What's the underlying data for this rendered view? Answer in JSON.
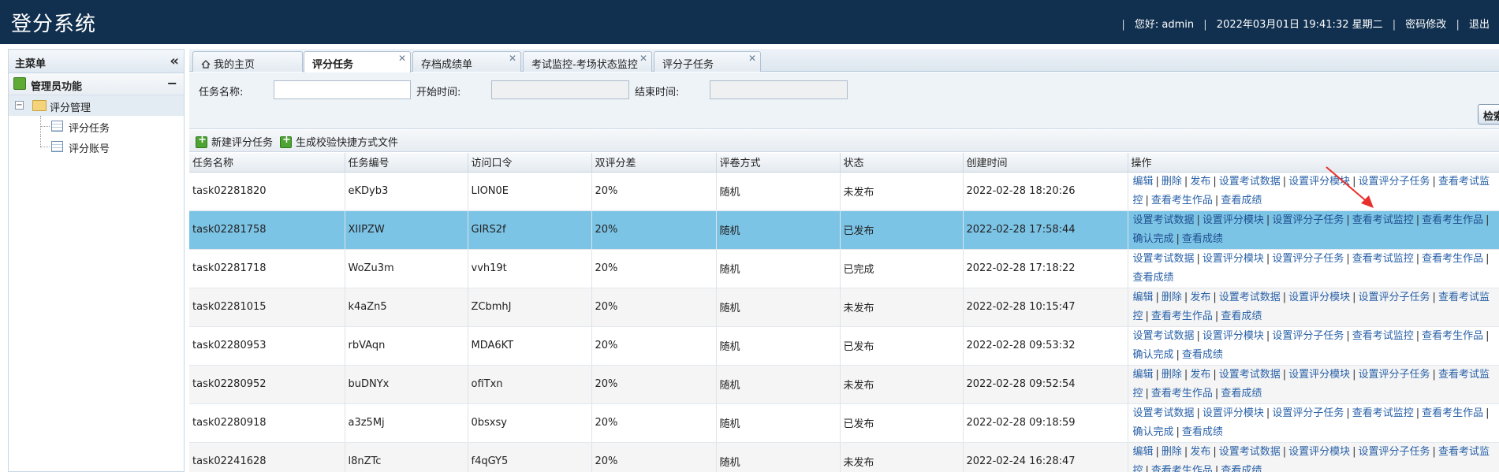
{
  "header": {
    "app_title": "登分系统",
    "greeting": "您好: admin",
    "datetime": "2022年03月01日 19:41:32 星期二",
    "change_password": "密码修改",
    "logout": "退出"
  },
  "sidebar": {
    "title": "主菜单",
    "collapse_icon": "«",
    "section_title": "管理员功能",
    "section_toggle": "−",
    "tree": {
      "root_label": "评分管理",
      "root_toggle": "−",
      "items": [
        {
          "label": "评分任务"
        },
        {
          "label": "评分账号"
        }
      ]
    }
  },
  "tabs": [
    {
      "label": "我的主页"
    },
    {
      "label": "评分任务",
      "active": true
    },
    {
      "label": "存档成绩单"
    },
    {
      "label": "考试监控-考场状态监控"
    },
    {
      "label": "评分子任务"
    }
  ],
  "search": {
    "task_name_label": "任务名称:",
    "task_name_value": "",
    "start_time_label": "开始时间:",
    "start_time_value": "",
    "end_time_label": "结束时间:",
    "end_time_value": "",
    "search_button": "检索"
  },
  "toolbar": {
    "new_task": "新建评分任务",
    "gen_shortcut": "生成校验快捷方式文件"
  },
  "table": {
    "columns": [
      "任务名称",
      "任务编号",
      "访问口令",
      "双评分差",
      "评卷方式",
      "状态",
      "创建时间",
      "操作"
    ],
    "rows": [
      {
        "name": "task02281820",
        "code": "eKDyb3",
        "token": "LION0E",
        "diff": "20%",
        "mode": "随机",
        "status": "未发布",
        "created": "2022-02-28 18:20:26",
        "ops": [
          "编辑",
          "删除",
          "发布",
          "设置考试数据",
          "设置评分模块",
          "设置评分子任务",
          "查看考试监控",
          "查看考生作品",
          "查看成绩"
        ]
      },
      {
        "name": "task02281758",
        "code": "XIIPZW",
        "token": "GIRS2f",
        "diff": "20%",
        "mode": "随机",
        "status": "已发布",
        "created": "2022-02-28 17:58:44",
        "ops": [
          "设置考试数据",
          "设置评分模块",
          "设置评分子任务",
          "查看考试监控",
          "查看考生作品",
          "确认完成",
          "查看成绩"
        ],
        "selected": true
      },
      {
        "name": "task02281718",
        "code": "WoZu3m",
        "token": "vvh19t",
        "diff": "20%",
        "mode": "随机",
        "status": "已完成",
        "created": "2022-02-28 17:18:22",
        "ops": [
          "设置考试数据",
          "设置评分模块",
          "设置评分子任务",
          "查看考试监控",
          "查看考生作品",
          "查看成绩"
        ]
      },
      {
        "name": "task02281015",
        "code": "k4aZn5",
        "token": "ZCbmhJ",
        "diff": "20%",
        "mode": "随机",
        "status": "未发布",
        "created": "2022-02-28 10:15:47",
        "ops": [
          "编辑",
          "删除",
          "发布",
          "设置考试数据",
          "设置评分模块",
          "设置评分子任务",
          "查看考试监控",
          "查看考生作品",
          "查看成绩"
        ]
      },
      {
        "name": "task02280953",
        "code": "rbVAqn",
        "token": "MDA6KT",
        "diff": "20%",
        "mode": "随机",
        "status": "已发布",
        "created": "2022-02-28 09:53:32",
        "ops": [
          "设置考试数据",
          "设置评分模块",
          "设置评分子任务",
          "查看考试监控",
          "查看考生作品",
          "确认完成",
          "查看成绩"
        ]
      },
      {
        "name": "task02280952",
        "code": "buDNYx",
        "token": "ofiTxn",
        "diff": "20%",
        "mode": "随机",
        "status": "未发布",
        "created": "2022-02-28 09:52:54",
        "ops": [
          "编辑",
          "删除",
          "发布",
          "设置考试数据",
          "设置评分模块",
          "设置评分子任务",
          "查看考试监控",
          "查看考生作品",
          "查看成绩"
        ]
      },
      {
        "name": "task02280918",
        "code": "a3z5Mj",
        "token": "0bsxsy",
        "diff": "20%",
        "mode": "随机",
        "status": "已发布",
        "created": "2022-02-28 09:18:59",
        "ops": [
          "设置考试数据",
          "设置评分模块",
          "设置评分子任务",
          "查看考试监控",
          "查看考生作品",
          "确认完成",
          "查看成绩"
        ]
      },
      {
        "name": "task02241628",
        "code": "l8nZTc",
        "token": "f4qGY5",
        "diff": "20%",
        "mode": "随机",
        "status": "未发布",
        "created": "2022-02-24 16:28:47",
        "ops": [
          "编辑",
          "删除",
          "发布",
          "设置考试数据",
          "设置评分模块",
          "设置评分子任务",
          "查看考试监控",
          "查看考生作品",
          "查看成绩"
        ]
      }
    ]
  },
  "colors": {
    "header_bg": "#11304f",
    "selected_row": "#7cc4e6",
    "link": "#2a62a8",
    "annotation_arrow": "#e8302a"
  }
}
